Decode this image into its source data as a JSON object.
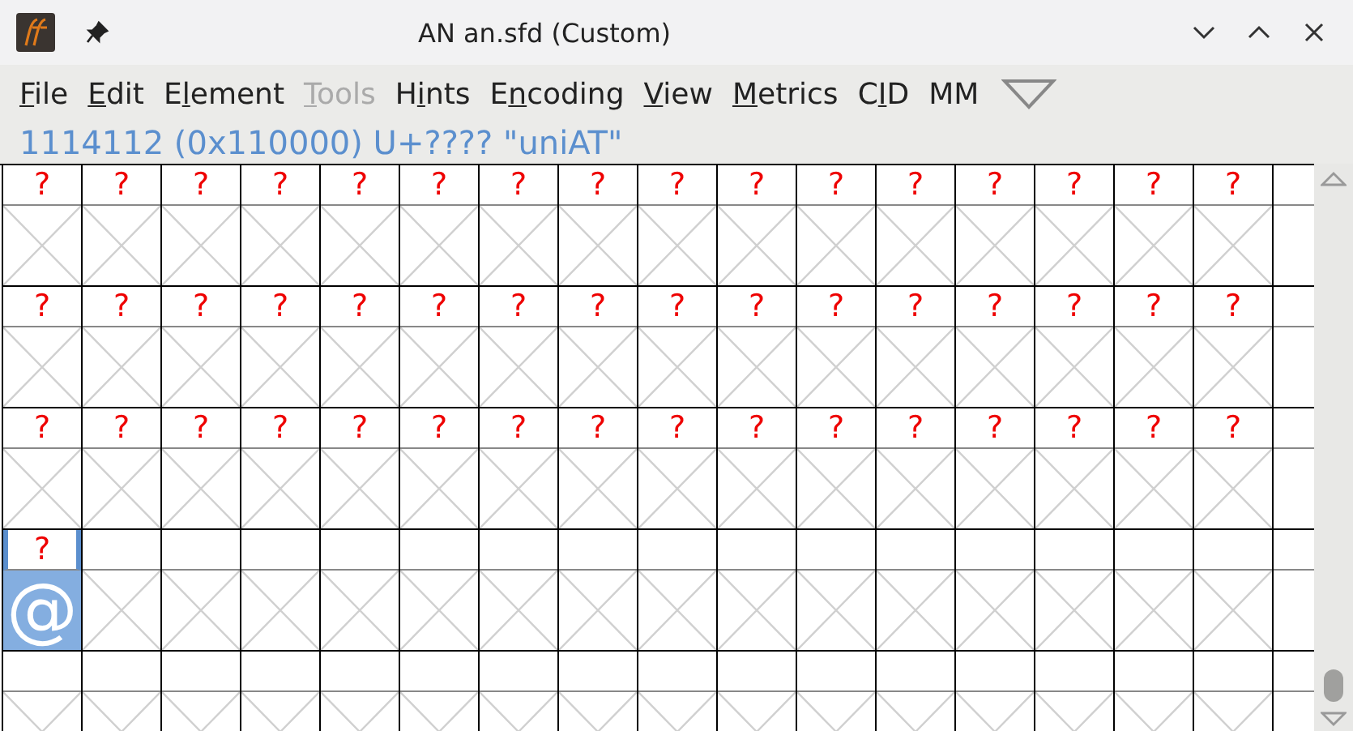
{
  "window": {
    "title": "AN an.sfd (Custom)"
  },
  "menu": [
    {
      "key": "F",
      "post": "ile",
      "disabled": false
    },
    {
      "key": "E",
      "post": "dit",
      "disabled": false
    },
    {
      "pre": "E",
      "key": "l",
      "post": "ement",
      "disabled": false
    },
    {
      "key": "T",
      "post": "ools",
      "disabled": true
    },
    {
      "pre": "H",
      "key": "i",
      "post": "nts",
      "disabled": false
    },
    {
      "pre": "E",
      "key": "n",
      "post": "coding",
      "disabled": false
    },
    {
      "key": "V",
      "post": "iew",
      "disabled": false
    },
    {
      "key": "M",
      "post": "etrics",
      "disabled": false
    },
    {
      "pre": "C",
      "key": "I",
      "post": "D",
      "disabled": false
    },
    {
      "pre": "MM",
      "disabled": false
    }
  ],
  "status": "1114112 (0x110000) U+???? \"uniAT\"",
  "grid": {
    "rows": [
      {
        "cells": [
          {
            "label": "?",
            "glyph": {
              "kind": "missing"
            },
            "selected": false
          },
          {
            "label": "?",
            "glyph": {
              "kind": "missing"
            },
            "selected": false
          },
          {
            "label": "?",
            "glyph": {
              "kind": "missing"
            },
            "selected": false
          },
          {
            "label": "?",
            "glyph": {
              "kind": "missing"
            },
            "selected": false
          },
          {
            "label": "?",
            "glyph": {
              "kind": "missing"
            },
            "selected": false
          },
          {
            "label": "?",
            "glyph": {
              "kind": "missing"
            },
            "selected": false
          },
          {
            "label": "?",
            "glyph": {
              "kind": "missing"
            },
            "selected": false
          },
          {
            "label": "?",
            "glyph": {
              "kind": "missing"
            },
            "selected": false
          },
          {
            "label": "?",
            "glyph": {
              "kind": "missing"
            },
            "selected": false
          },
          {
            "label": "?",
            "glyph": {
              "kind": "missing"
            },
            "selected": false
          },
          {
            "label": "?",
            "glyph": {
              "kind": "missing"
            },
            "selected": false
          },
          {
            "label": "?",
            "glyph": {
              "kind": "missing"
            },
            "selected": false
          },
          {
            "label": "?",
            "glyph": {
              "kind": "missing"
            },
            "selected": false
          },
          {
            "label": "?",
            "glyph": {
              "kind": "missing"
            },
            "selected": false
          },
          {
            "label": "?",
            "glyph": {
              "kind": "missing"
            },
            "selected": false
          },
          {
            "label": "?",
            "glyph": {
              "kind": "missing"
            },
            "selected": false
          },
          {
            "glyph": {
              "kind": "blank"
            },
            "selected": false
          }
        ]
      },
      {
        "cells": [
          {
            "label": "?",
            "glyph": {
              "kind": "missing"
            },
            "selected": false
          },
          {
            "label": "?",
            "glyph": {
              "kind": "missing"
            },
            "selected": false
          },
          {
            "label": "?",
            "glyph": {
              "kind": "missing"
            },
            "selected": false
          },
          {
            "label": "?",
            "glyph": {
              "kind": "missing"
            },
            "selected": false
          },
          {
            "label": "?",
            "glyph": {
              "kind": "missing"
            },
            "selected": false
          },
          {
            "label": "?",
            "glyph": {
              "kind": "missing"
            },
            "selected": false
          },
          {
            "label": "?",
            "glyph": {
              "kind": "missing"
            },
            "selected": false
          },
          {
            "label": "?",
            "glyph": {
              "kind": "missing"
            },
            "selected": false
          },
          {
            "label": "?",
            "glyph": {
              "kind": "missing"
            },
            "selected": false
          },
          {
            "label": "?",
            "glyph": {
              "kind": "missing"
            },
            "selected": false
          },
          {
            "label": "?",
            "glyph": {
              "kind": "missing"
            },
            "selected": false
          },
          {
            "label": "?",
            "glyph": {
              "kind": "missing"
            },
            "selected": false
          },
          {
            "label": "?",
            "glyph": {
              "kind": "missing"
            },
            "selected": false
          },
          {
            "label": "?",
            "glyph": {
              "kind": "missing"
            },
            "selected": false
          },
          {
            "label": "?",
            "glyph": {
              "kind": "missing"
            },
            "selected": false
          },
          {
            "label": "?",
            "glyph": {
              "kind": "missing"
            },
            "selected": false
          },
          {
            "glyph": {
              "kind": "blank"
            },
            "selected": false
          }
        ]
      },
      {
        "cells": [
          {
            "label": "?",
            "glyph": {
              "kind": "missing"
            },
            "selected": false
          },
          {
            "label": "?",
            "glyph": {
              "kind": "missing"
            },
            "selected": false
          },
          {
            "label": "?",
            "glyph": {
              "kind": "missing"
            },
            "selected": false
          },
          {
            "label": "?",
            "glyph": {
              "kind": "missing"
            },
            "selected": false
          },
          {
            "label": "?",
            "glyph": {
              "kind": "missing"
            },
            "selected": false
          },
          {
            "label": "?",
            "glyph": {
              "kind": "missing"
            },
            "selected": false
          },
          {
            "label": "?",
            "glyph": {
              "kind": "missing"
            },
            "selected": false
          },
          {
            "label": "?",
            "glyph": {
              "kind": "missing"
            },
            "selected": false
          },
          {
            "label": "?",
            "glyph": {
              "kind": "missing"
            },
            "selected": false
          },
          {
            "label": "?",
            "glyph": {
              "kind": "missing"
            },
            "selected": false
          },
          {
            "label": "?",
            "glyph": {
              "kind": "missing"
            },
            "selected": false
          },
          {
            "label": "?",
            "glyph": {
              "kind": "missing"
            },
            "selected": false
          },
          {
            "label": "?",
            "glyph": {
              "kind": "missing"
            },
            "selected": false
          },
          {
            "label": "?",
            "glyph": {
              "kind": "missing"
            },
            "selected": false
          },
          {
            "label": "?",
            "glyph": {
              "kind": "missing"
            },
            "selected": false
          },
          {
            "label": "?",
            "glyph": {
              "kind": "missing"
            },
            "selected": false
          },
          {
            "glyph": {
              "kind": "blank"
            },
            "selected": false
          }
        ]
      },
      {
        "cells": [
          {
            "label": "?",
            "glyph": {
              "kind": "char",
              "text": "@"
            },
            "selected": true
          },
          {
            "glyph": {
              "kind": "missing"
            },
            "selected": false
          },
          {
            "glyph": {
              "kind": "missing"
            },
            "selected": false
          },
          {
            "glyph": {
              "kind": "missing"
            },
            "selected": false
          },
          {
            "glyph": {
              "kind": "missing"
            },
            "selected": false
          },
          {
            "glyph": {
              "kind": "missing"
            },
            "selected": false
          },
          {
            "glyph": {
              "kind": "missing"
            },
            "selected": false
          },
          {
            "glyph": {
              "kind": "missing"
            },
            "selected": false
          },
          {
            "glyph": {
              "kind": "missing"
            },
            "selected": false
          },
          {
            "glyph": {
              "kind": "missing"
            },
            "selected": false
          },
          {
            "glyph": {
              "kind": "missing"
            },
            "selected": false
          },
          {
            "glyph": {
              "kind": "missing"
            },
            "selected": false
          },
          {
            "glyph": {
              "kind": "missing"
            },
            "selected": false
          },
          {
            "glyph": {
              "kind": "missing"
            },
            "selected": false
          },
          {
            "glyph": {
              "kind": "missing"
            },
            "selected": false
          },
          {
            "glyph": {
              "kind": "missing"
            },
            "selected": false
          },
          {
            "glyph": {
              "kind": "blank"
            },
            "selected": false
          }
        ]
      },
      {
        "cells": [
          {
            "glyph": {
              "kind": "missing"
            },
            "selected": false
          },
          {
            "glyph": {
              "kind": "missing"
            },
            "selected": false
          },
          {
            "glyph": {
              "kind": "missing"
            },
            "selected": false
          },
          {
            "glyph": {
              "kind": "missing"
            },
            "selected": false
          },
          {
            "glyph": {
              "kind": "missing"
            },
            "selected": false
          },
          {
            "glyph": {
              "kind": "missing"
            },
            "selected": false
          },
          {
            "glyph": {
              "kind": "missing"
            },
            "selected": false
          },
          {
            "glyph": {
              "kind": "missing"
            },
            "selected": false
          },
          {
            "glyph": {
              "kind": "missing"
            },
            "selected": false
          },
          {
            "glyph": {
              "kind": "missing"
            },
            "selected": false
          },
          {
            "glyph": {
              "kind": "missing"
            },
            "selected": false
          },
          {
            "glyph": {
              "kind": "missing"
            },
            "selected": false
          },
          {
            "glyph": {
              "kind": "missing"
            },
            "selected": false
          },
          {
            "glyph": {
              "kind": "missing"
            },
            "selected": false
          },
          {
            "glyph": {
              "kind": "missing"
            },
            "selected": false
          },
          {
            "glyph": {
              "kind": "missing"
            },
            "selected": false
          },
          {
            "glyph": {
              "kind": "blank"
            },
            "selected": false
          }
        ]
      }
    ]
  }
}
